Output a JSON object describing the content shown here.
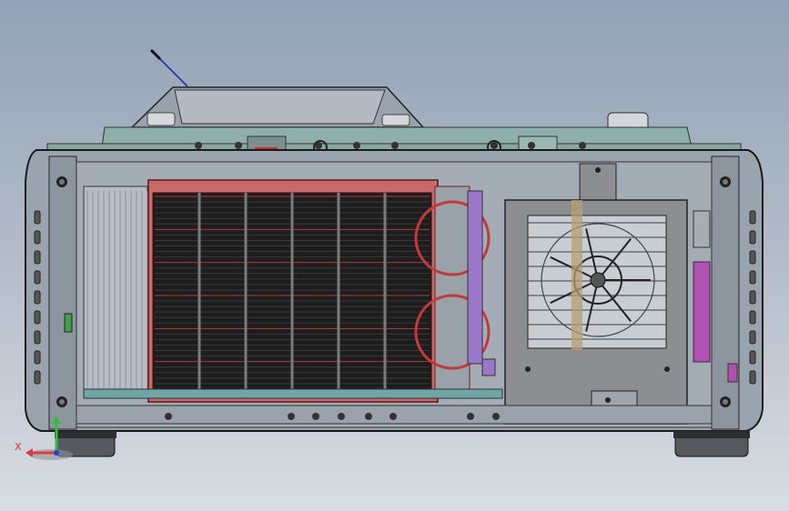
{
  "axis_triad": {
    "x_label": "X",
    "x_color": "#e23b3b",
    "y_color": "#2fbf3a",
    "z_color": "#2b3fd6"
  },
  "colors": {
    "background_top": "#93a2b6",
    "background_bottom": "#d9dde3",
    "top_plate": "#8fb0aa",
    "heatsink_frame": "#d96b6b",
    "fan_housing": "#8c8e92",
    "purple_part": "#9a77c8",
    "magenta_pcb": "#b050b0"
  },
  "parts": {
    "heatsink_fin_rows": 36,
    "heatsink_columns": 6,
    "fan_blades": 7
  }
}
